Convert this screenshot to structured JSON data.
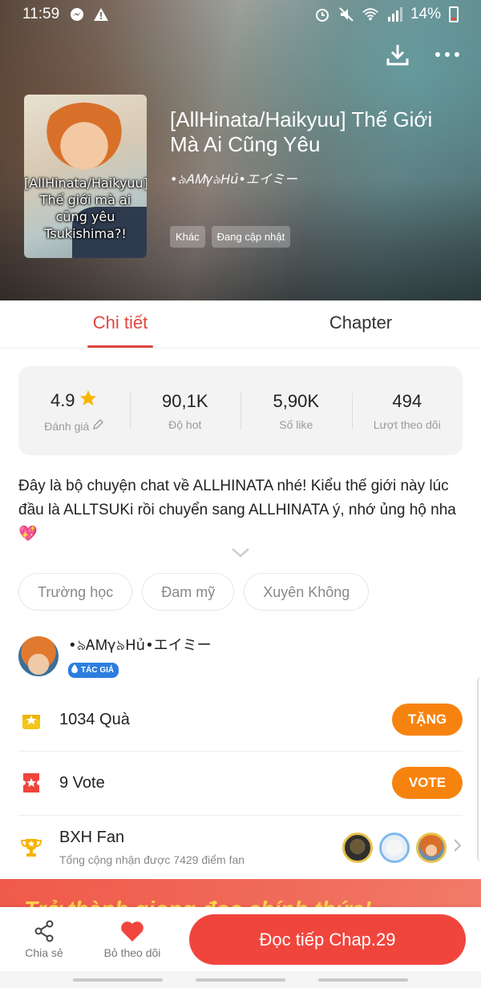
{
  "status_bar": {
    "time": "11:59",
    "battery": "14%"
  },
  "header": {
    "title": "[AllHinata/Haikyuu] Thế Giới Mà Ai Cũng Yêu",
    "author": "•৯ᎪᎷγ৯Hủ•エイミー",
    "tags": [
      "Khác",
      "Đang cập nhật"
    ],
    "cover_text": [
      "[AllHinata/Haikyuu]",
      "Thế giới mà ai",
      "cũng yêu",
      "Tsukishima?!"
    ]
  },
  "tabs": [
    {
      "label": "Chi tiết",
      "active": true
    },
    {
      "label": "Chapter",
      "active": false
    }
  ],
  "stats": [
    {
      "value": "4.9",
      "label": "Đánh giá",
      "icon": "star-icon"
    },
    {
      "value": "90,1K",
      "label": "Độ hot"
    },
    {
      "value": "5,90K",
      "label": "Số like"
    },
    {
      "value": "494",
      "label": "Lượt theo dõi"
    }
  ],
  "description": "Đây là bộ chuyện chat về ALLHINATA nhé! Kiểu thế giới này lúc đầu là ALLTSUKi rồi chuyển sang ALLHINATA ý, nhớ ủng hộ nha 💖",
  "genres": [
    "Trường học",
    "Đam mỹ",
    "Xuyên Không"
  ],
  "author_section": {
    "name": "•৯ᎪᎷγ৯Hủ•エイミー",
    "badge": "TÁC GIẢ"
  },
  "gifts": {
    "count_label": "1034 Quà",
    "button": "TẶNG"
  },
  "votes": {
    "count_label": "9 Vote",
    "button": "VOTE"
  },
  "fan_rank": {
    "title": "BXH Fan",
    "subtitle": "Tổng cộng nhận được 7429 điểm fan"
  },
  "banner": {
    "text": "Trở thành giọng đọc chính thức!"
  },
  "bottom_bar": {
    "share": "Chia sẻ",
    "unfollow": "Bỏ theo dõi",
    "read_button": "Đọc tiếp Chap.29"
  },
  "colors": {
    "accent": "#e0463f",
    "orange": "#f7830f",
    "read_button": "#f0453d"
  }
}
